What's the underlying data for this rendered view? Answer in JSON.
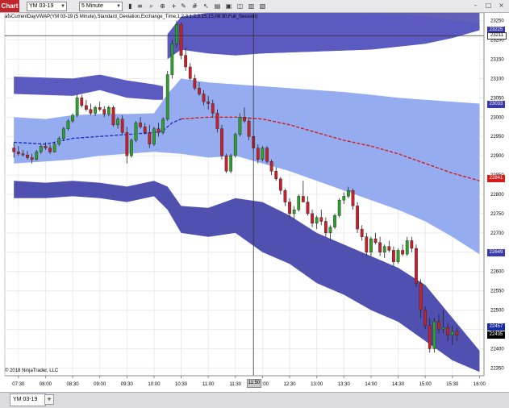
{
  "toolbar": {
    "chart_label": "Chart",
    "instrument": "YM 03-19",
    "interval": "5 Minute",
    "icons": [
      "bars-icon",
      "chart-style-icon",
      "magnifier-icon",
      "zoom-icon",
      "pointer-icon",
      "crosshair-icon",
      "draw-icon",
      "hash-icon",
      "indicators-icon",
      "strategies-icon",
      "properties-icon",
      "tools-icon",
      "windows-icon",
      "more-icon"
    ]
  },
  "window_buttons": {
    "minimize": "–",
    "maximize": "□",
    "close": "×"
  },
  "indicator_label": "afsCurrentDayVWAP(YM 03-19 (5 Minute),Standard_Deviation,Exchange_Time,1,2,3,1,2,3,15,15,08:30,Full_Session)",
  "copyright": "© 2018 NinjaTrader, LLC",
  "price_axis": {
    "ticks": [
      "23250",
      "23200",
      "23150",
      "23100",
      "23050",
      "23000",
      "22950",
      "22900",
      "22850",
      "22800",
      "22750",
      "22700",
      "22650",
      "22600",
      "22550",
      "22500",
      "22450",
      "22400",
      "22350"
    ],
    "flags": [
      {
        "label": "23225",
        "color": "#3a3aa8"
      },
      {
        "label": "23211",
        "color": "#ffffff",
        "text_color": "#000000"
      },
      {
        "label": "23033",
        "color": "#3a3aa8"
      },
      {
        "label": "22841",
        "color": "#d41c1c"
      },
      {
        "label": "22649",
        "color": "#3a3aa8"
      },
      {
        "label": "22457",
        "color": "#1a2aa0"
      },
      {
        "label": "22435",
        "color": "#000000"
      }
    ]
  },
  "time_axis": {
    "ticks": [
      "07:30",
      "08:00",
      "08:30",
      "09:00",
      "09:30",
      "10:00",
      "10:30",
      "11:00",
      "11:30",
      "12:00",
      "12:30",
      "13:00",
      "13:30",
      "14:00",
      "14:30",
      "15:00",
      "15:30",
      "16:00"
    ]
  },
  "crosshair": {
    "time": "11:50",
    "price": "23211"
  },
  "bottom_tabs": {
    "active": "YM 03-19",
    "add": "+"
  },
  "chart_data": {
    "type": "candlestick",
    "instrument": "YM 03-19",
    "interval": "5 Minute",
    "y_range": [
      22330,
      23270
    ],
    "session_start": "07:15",
    "session_end": "16:05",
    "vwap_session_start": "10:00",
    "colors": {
      "up": "#2ca02c",
      "down": "#c8202a",
      "vwap": "#d41c1c",
      "band1": "#8fa8ef",
      "band2": "#5a5ac0",
      "band3": "#5050b0"
    },
    "candles": [
      [
        "07:25",
        22920,
        22935,
        22895,
        22910
      ],
      [
        "07:30",
        22910,
        22925,
        22900,
        22905
      ],
      [
        "07:35",
        22905,
        22915,
        22898,
        22902
      ],
      [
        "07:40",
        22902,
        22912,
        22890,
        22895
      ],
      [
        "07:45",
        22895,
        22905,
        22880,
        22890
      ],
      [
        "07:50",
        22890,
        22915,
        22888,
        22910
      ],
      [
        "07:55",
        22910,
        22930,
        22905,
        22925
      ],
      [
        "08:00",
        22925,
        22935,
        22915,
        22920
      ],
      [
        "08:05",
        22920,
        22928,
        22905,
        22910
      ],
      [
        "08:10",
        22910,
        22935,
        22908,
        22930
      ],
      [
        "08:15",
        22930,
        22950,
        22925,
        22945
      ],
      [
        "08:20",
        22945,
        22975,
        22940,
        22970
      ],
      [
        "08:25",
        22970,
        22995,
        22965,
        22990
      ],
      [
        "08:30",
        22990,
        23010,
        22985,
        23005
      ],
      [
        "08:35",
        23005,
        23060,
        23000,
        23050
      ],
      [
        "08:40",
        23050,
        23058,
        23025,
        23030
      ],
      [
        "08:45",
        23030,
        23045,
        23015,
        23020
      ],
      [
        "08:50",
        23020,
        23035,
        23005,
        23010
      ],
      [
        "08:55",
        23010,
        23030,
        23002,
        23025
      ],
      [
        "09:00",
        23025,
        23040,
        23015,
        23020
      ],
      [
        "09:05",
        23020,
        23028,
        23000,
        23008
      ],
      [
        "09:10",
        23008,
        23030,
        23002,
        23025
      ],
      [
        "09:15",
        23025,
        23030,
        22975,
        22980
      ],
      [
        "09:20",
        22980,
        23000,
        22970,
        22995
      ],
      [
        "09:25",
        22995,
        23005,
        22955,
        22960
      ],
      [
        "09:30",
        22960,
        22975,
        22880,
        22900
      ],
      [
        "09:35",
        22900,
        22945,
        22895,
        22940
      ],
      [
        "09:40",
        22940,
        22990,
        22935,
        22985
      ],
      [
        "09:45",
        22985,
        23000,
        22970,
        22975
      ],
      [
        "09:50",
        22975,
        22985,
        22955,
        22960
      ],
      [
        "09:55",
        22960,
        22980,
        22920,
        22930
      ],
      [
        "10:00",
        22930,
        22975,
        22925,
        22970
      ],
      [
        "10:05",
        22970,
        22985,
        22950,
        22960
      ],
      [
        "10:10",
        22960,
        23000,
        22955,
        22995
      ],
      [
        "10:15",
        22995,
        23120,
        22990,
        23110
      ],
      [
        "10:20",
        23110,
        23200,
        23100,
        23190
      ],
      [
        "10:25",
        23190,
        23250,
        23180,
        23240
      ],
      [
        "10:30",
        23240,
        23245,
        23150,
        23160
      ],
      [
        "10:35",
        23160,
        23180,
        23120,
        23130
      ],
      [
        "10:40",
        23130,
        23140,
        23095,
        23100
      ],
      [
        "10:45",
        23100,
        23110,
        23070,
        23075
      ],
      [
        "10:50",
        23075,
        23090,
        23055,
        23060
      ],
      [
        "10:55",
        23060,
        23070,
        23030,
        23040
      ],
      [
        "11:00",
        23040,
        23055,
        23020,
        23035
      ],
      [
        "11:05",
        23035,
        23045,
        23000,
        23010
      ],
      [
        "11:10",
        23010,
        23020,
        22960,
        22970
      ],
      [
        "11:15",
        22970,
        22980,
        22890,
        22900
      ],
      [
        "11:20",
        22900,
        22905,
        22855,
        22860
      ],
      [
        "11:25",
        22860,
        22905,
        22855,
        22900
      ],
      [
        "11:30",
        22900,
        22960,
        22895,
        22955
      ],
      [
        "11:35",
        22955,
        23010,
        22950,
        23000
      ],
      [
        "11:40",
        23000,
        23025,
        22985,
        22990
      ],
      [
        "11:45",
        22990,
        23000,
        22940,
        22950
      ],
      [
        "11:50",
        22950,
        22955,
        22910,
        22920
      ],
      [
        "11:55",
        22920,
        22930,
        22880,
        22890
      ],
      [
        "12:00",
        22890,
        22925,
        22885,
        22920
      ],
      [
        "12:05",
        22920,
        22925,
        22880,
        22885
      ],
      [
        "12:10",
        22885,
        22890,
        22850,
        22860
      ],
      [
        "12:15",
        22860,
        22870,
        22835,
        22840
      ],
      [
        "12:20",
        22840,
        22845,
        22800,
        22810
      ],
      [
        "12:25",
        22810,
        22815,
        22770,
        22780
      ],
      [
        "12:30",
        22780,
        22790,
        22740,
        22750
      ],
      [
        "12:35",
        22750,
        22770,
        22735,
        22760
      ],
      [
        "12:40",
        22760,
        22800,
        22755,
        22795
      ],
      [
        "12:45",
        22795,
        22835,
        22790,
        22780
      ],
      [
        "12:50",
        22780,
        22795,
        22745,
        22750
      ],
      [
        "12:55",
        22750,
        22760,
        22715,
        22725
      ],
      [
        "13:00",
        22725,
        22745,
        22710,
        22740
      ],
      [
        "13:05",
        22740,
        22760,
        22720,
        22730
      ],
      [
        "13:10",
        22730,
        22740,
        22690,
        22700
      ],
      [
        "13:15",
        22700,
        22720,
        22680,
        22715
      ],
      [
        "13:20",
        22715,
        22750,
        22710,
        22745
      ],
      [
        "13:25",
        22745,
        22790,
        22740,
        22785
      ],
      [
        "13:30",
        22785,
        22805,
        22775,
        22795
      ],
      [
        "13:35",
        22795,
        22820,
        22790,
        22810
      ],
      [
        "13:40",
        22810,
        22815,
        22760,
        22770
      ],
      [
        "13:45",
        22770,
        22780,
        22700,
        22710
      ],
      [
        "13:50",
        22710,
        22720,
        22680,
        22690
      ],
      [
        "13:55",
        22690,
        22700,
        22640,
        22650
      ],
      [
        "14:00",
        22650,
        22690,
        22640,
        22685
      ],
      [
        "14:05",
        22685,
        22700,
        22670,
        22675
      ],
      [
        "14:10",
        22675,
        22690,
        22640,
        22650
      ],
      [
        "14:15",
        22650,
        22670,
        22635,
        22665
      ],
      [
        "14:20",
        22665,
        22680,
        22650,
        22655
      ],
      [
        "14:25",
        22655,
        22665,
        22615,
        22625
      ],
      [
        "14:30",
        22625,
        22660,
        22620,
        22655
      ],
      [
        "14:35",
        22655,
        22670,
        22640,
        22645
      ],
      [
        "14:40",
        22645,
        22690,
        22640,
        22680
      ],
      [
        "14:45",
        22680,
        22690,
        22650,
        22660
      ],
      [
        "14:50",
        22660,
        22670,
        22560,
        22570
      ],
      [
        "14:55",
        22570,
        22580,
        22480,
        22500
      ],
      [
        "15:00",
        22500,
        22510,
        22450,
        22460
      ],
      [
        "15:05",
        22460,
        22480,
        22390,
        22400
      ],
      [
        "15:10",
        22400,
        22480,
        22390,
        22470
      ],
      [
        "15:15",
        22470,
        22490,
        22440,
        22450
      ],
      [
        "15:20",
        22450,
        22500,
        22440,
        22455
      ],
      [
        "15:25",
        22455,
        22465,
        22420,
        22435
      ],
      [
        "15:30",
        22435,
        22460,
        22410,
        22445
      ],
      [
        "15:35",
        22445,
        22455,
        22420,
        22435
      ]
    ],
    "vwap_line": [
      [
        "07:25",
        22935
      ],
      [
        "08:00",
        22930
      ],
      [
        "08:30",
        22945
      ],
      [
        "09:00",
        22950
      ],
      [
        "09:30",
        22955
      ],
      [
        "10:00",
        22960
      ],
      [
        "10:10",
        22965
      ],
      [
        "10:20",
        22985
      ],
      [
        "10:30",
        22995
      ],
      [
        "11:00",
        23000
      ],
      [
        "11:30",
        23000
      ],
      [
        "12:00",
        22995
      ],
      [
        "12:30",
        22980
      ],
      [
        "13:00",
        22960
      ],
      [
        "13:30",
        22940
      ],
      [
        "14:00",
        22925
      ],
      [
        "14:30",
        22905
      ],
      [
        "15:00",
        22880
      ],
      [
        "15:30",
        22855
      ],
      [
        "16:00",
        22835
      ]
    ],
    "band1_upper": [
      [
        "07:25",
        23000
      ],
      [
        "08:00",
        22995
      ],
      [
        "08:30",
        23005
      ],
      [
        "09:00",
        23008
      ],
      [
        "09:30",
        23008
      ],
      [
        "10:00",
        23010
      ],
      [
        "10:15",
        23060
      ],
      [
        "10:30",
        23100
      ],
      [
        "11:00",
        23090
      ],
      [
        "11:30",
        23085
      ],
      [
        "12:00",
        23080
      ],
      [
        "12:30",
        23075
      ],
      [
        "13:00",
        23070
      ],
      [
        "13:30",
        23065
      ],
      [
        "14:00",
        23058
      ],
      [
        "14:30",
        23050
      ],
      [
        "15:00",
        23045
      ],
      [
        "15:30",
        23040
      ],
      [
        "16:00",
        23035
      ]
    ],
    "band1_lower": [
      [
        "07:25",
        22880
      ],
      [
        "08:00",
        22885
      ],
      [
        "08:30",
        22890
      ],
      [
        "09:00",
        22900
      ],
      [
        "09:30",
        22905
      ],
      [
        "10:00",
        22910
      ],
      [
        "10:30",
        22905
      ],
      [
        "11:00",
        22895
      ],
      [
        "11:30",
        22900
      ],
      [
        "12:00",
        22880
      ],
      [
        "12:30",
        22860
      ],
      [
        "13:00",
        22835
      ],
      [
        "13:30",
        22810
      ],
      [
        "14:00",
        22785
      ],
      [
        "14:30",
        22760
      ],
      [
        "15:00",
        22730
      ],
      [
        "15:30",
        22690
      ],
      [
        "16:00",
        22645
      ]
    ],
    "band2_upper": [
      [
        "07:25",
        23105
      ],
      [
        "08:30",
        23100
      ],
      [
        "09:00",
        23110
      ],
      [
        "09:30",
        23095
      ],
      [
        "10:00",
        23085
      ],
      [
        "10:10",
        23080
      ],
      [
        "10:15",
        23150
      ],
      [
        "10:30",
        23175
      ],
      [
        "11:00",
        23165
      ],
      [
        "11:30",
        23160
      ],
      [
        "12:00",
        23165
      ],
      [
        "13:00",
        23170
      ],
      [
        "14:00",
        23175
      ],
      [
        "15:00",
        23190
      ],
      [
        "15:30",
        23205
      ],
      [
        "16:00",
        23225
      ]
    ],
    "band2_lower": [
      [
        "07:25",
        22835
      ],
      [
        "08:00",
        22830
      ],
      [
        "08:30",
        22835
      ],
      [
        "09:00",
        22830
      ],
      [
        "09:30",
        22820
      ],
      [
        "10:00",
        22835
      ],
      [
        "10:15",
        22820
      ],
      [
        "10:30",
        22760
      ],
      [
        "11:00",
        22755
      ],
      [
        "11:30",
        22800
      ],
      [
        "12:00",
        22790
      ],
      [
        "12:30",
        22750
      ],
      [
        "13:00",
        22700
      ],
      [
        "13:30",
        22670
      ],
      [
        "14:00",
        22640
      ],
      [
        "14:30",
        22610
      ],
      [
        "15:00",
        22560
      ],
      [
        "15:30",
        22470
      ],
      [
        "16:00",
        22380
      ]
    ],
    "band3_upper": [
      [
        "10:15",
        23210
      ],
      [
        "10:30",
        23260
      ],
      [
        "11:00",
        23270
      ],
      [
        "16:00",
        23270
      ]
    ],
    "band3_lower": [
      [
        "10:15",
        22760
      ],
      [
        "10:30",
        22700
      ],
      [
        "11:00",
        22690
      ],
      [
        "11:30",
        22700
      ],
      [
        "12:00",
        22650
      ],
      [
        "12:30",
        22620
      ],
      [
        "13:00",
        22570
      ],
      [
        "13:30",
        22540
      ],
      [
        "14:00",
        22500
      ],
      [
        "14:30",
        22470
      ],
      [
        "15:00",
        22420
      ],
      [
        "15:30",
        22370
      ],
      [
        "16:00",
        22340
      ]
    ]
  }
}
